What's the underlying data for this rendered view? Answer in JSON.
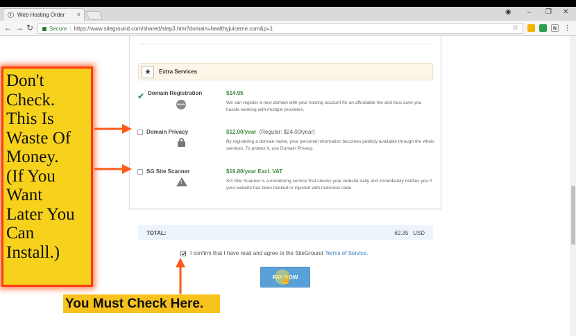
{
  "browser": {
    "tab_title": "Web Hosting Order",
    "tab_close": "×",
    "secure_label": "Secure",
    "url": "https://www.siteground.com/shared/step3.htm?domain=healthyjuiceme.com&p=1"
  },
  "extras": {
    "header_title": "Extra Services",
    "services": [
      {
        "name": "Domain Registration",
        "price": "$14.95",
        "regular": "",
        "desc": "We can register a new domain with your hosting account for an affordable fee and thus save you hassle working with multiple providers.",
        "icon_text": "WWW",
        "checked": true
      },
      {
        "name": "Domain Privacy",
        "price": "$12.00/year",
        "regular": "(Regular: $24.00/year)",
        "desc": "By registering a domain name, your personal information becomes publicly available through the whois services. To protect it, use Domain Privacy.",
        "checked": false
      },
      {
        "name": "SG Site Scanner",
        "price": "$19.80/year Excl. VAT",
        "regular": "",
        "desc": "SG Site Scanner is a monitoring service that checks your website daily and immediately notifies you if your website has been hacked or injected with malicious code.",
        "checked": false
      }
    ]
  },
  "order": {
    "total_label": "TOTAL:",
    "total_value": "62.35",
    "currency": "USD",
    "confirm_text": "I confirm that I have read and agree to the SiteGround",
    "tos_link": "Terms of Service.",
    "pay_label": "PAY NOW"
  },
  "annotations": {
    "callout_text": "Don't\nCheck.\nThis Is\nWaste Of\nMoney.\n(If You\nWant\nLater You\nCan\nInstall.)",
    "banner_text": "You Must Check Here."
  },
  "colors": {
    "callout_bg": "#f7d21d",
    "callout_border": "#ff3b10",
    "arrow": "#ff5a1a",
    "price_green": "#3d8b3d",
    "pay_button": "#5aa0d8"
  }
}
